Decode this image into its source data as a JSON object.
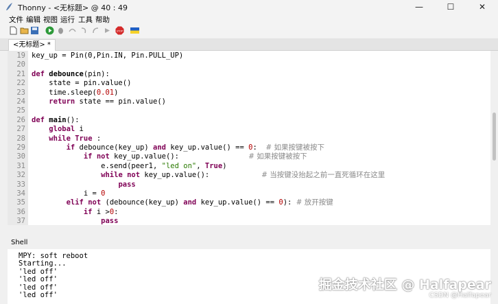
{
  "window": {
    "title": "Thonny  -  <无标题>  @  40 : 49",
    "controls": {
      "minimize": "—",
      "maximize": "☐",
      "close": "✕"
    }
  },
  "menu": [
    "文件",
    "编辑",
    "视图",
    "运行",
    "工具",
    "帮助"
  ],
  "toolbar": {
    "icons": [
      "new-file-icon",
      "open-file-icon",
      "save-icon",
      "run-icon",
      "debug-icon",
      "step-over-icon",
      "step-into-icon",
      "step-out-icon",
      "resume-icon",
      "stop-icon",
      "ukraine-flag-icon"
    ],
    "stop_label": "STOP"
  },
  "tabs": [
    {
      "label": "<无标题> *"
    }
  ],
  "editor": {
    "lines": [
      {
        "n": "19",
        "tokens": [
          {
            "t": "key_up = Pin(0,Pin.IN, Pin.PULL_UP)",
            "c": ""
          }
        ]
      },
      {
        "n": "20",
        "tokens": []
      },
      {
        "n": "21",
        "tokens": [
          {
            "t": "def ",
            "c": "kw"
          },
          {
            "t": "debounce",
            "c": "fn"
          },
          {
            "t": "(pin):",
            "c": ""
          }
        ]
      },
      {
        "n": "22",
        "tokens": [
          {
            "t": "    state = pin.value()",
            "c": ""
          }
        ]
      },
      {
        "n": "23",
        "tokens": [
          {
            "t": "    time.sleep(",
            "c": ""
          },
          {
            "t": "0.01",
            "c": "num"
          },
          {
            "t": ")",
            "c": ""
          }
        ]
      },
      {
        "n": "24",
        "tokens": [
          {
            "t": "    ",
            "c": ""
          },
          {
            "t": "return",
            "c": "kw"
          },
          {
            "t": " state == pin.value()",
            "c": ""
          }
        ]
      },
      {
        "n": "25",
        "tokens": []
      },
      {
        "n": "26",
        "tokens": [
          {
            "t": "def ",
            "c": "kw"
          },
          {
            "t": "main",
            "c": "fn"
          },
          {
            "t": "():",
            "c": ""
          }
        ]
      },
      {
        "n": "27",
        "tokens": [
          {
            "t": "    ",
            "c": ""
          },
          {
            "t": "global",
            "c": "kw"
          },
          {
            "t": " i",
            "c": ""
          }
        ]
      },
      {
        "n": "28",
        "tokens": [
          {
            "t": "    ",
            "c": ""
          },
          {
            "t": "while",
            "c": "kw"
          },
          {
            "t": " ",
            "c": ""
          },
          {
            "t": "True",
            "c": "kw"
          },
          {
            "t": " :",
            "c": ""
          }
        ]
      },
      {
        "n": "29",
        "tokens": [
          {
            "t": "        ",
            "c": ""
          },
          {
            "t": "if",
            "c": "kw"
          },
          {
            "t": " debounce(key_up) ",
            "c": ""
          },
          {
            "t": "and",
            "c": "kw"
          },
          {
            "t": " key_up.value() == ",
            "c": ""
          },
          {
            "t": "0",
            "c": "num"
          },
          {
            "t": ":  ",
            "c": ""
          },
          {
            "t": "# 如果按键被按下",
            "c": "cmt"
          }
        ]
      },
      {
        "n": "30",
        "tokens": [
          {
            "t": "            ",
            "c": ""
          },
          {
            "t": "if",
            "c": "kw"
          },
          {
            "t": " ",
            "c": ""
          },
          {
            "t": "not",
            "c": "kw"
          },
          {
            "t": " key_up.value():                ",
            "c": ""
          },
          {
            "t": "# 如果按键被按下",
            "c": "cmt"
          }
        ]
      },
      {
        "n": "31",
        "tokens": [
          {
            "t": "                e.send(peer1, ",
            "c": ""
          },
          {
            "t": "\"led on\"",
            "c": "str"
          },
          {
            "t": ", ",
            "c": ""
          },
          {
            "t": "True",
            "c": "kw"
          },
          {
            "t": ")",
            "c": ""
          }
        ]
      },
      {
        "n": "32",
        "tokens": [
          {
            "t": "                ",
            "c": ""
          },
          {
            "t": "while",
            "c": "kw"
          },
          {
            "t": " ",
            "c": ""
          },
          {
            "t": "not",
            "c": "kw"
          },
          {
            "t": " key_up.value():            ",
            "c": ""
          },
          {
            "t": "# 当按键没抬起之前一直死循环在这里",
            "c": "cmt"
          }
        ]
      },
      {
        "n": "33",
        "tokens": [
          {
            "t": "                    ",
            "c": ""
          },
          {
            "t": "pass",
            "c": "kw"
          }
        ]
      },
      {
        "n": "34",
        "tokens": [
          {
            "t": "            i = ",
            "c": ""
          },
          {
            "t": "0",
            "c": "num"
          }
        ]
      },
      {
        "n": "35",
        "tokens": [
          {
            "t": "        ",
            "c": ""
          },
          {
            "t": "elif",
            "c": "kw"
          },
          {
            "t": " ",
            "c": ""
          },
          {
            "t": "not",
            "c": "kw"
          },
          {
            "t": " (debounce(key_up) ",
            "c": ""
          },
          {
            "t": "and",
            "c": "kw"
          },
          {
            "t": " key_up.value() == ",
            "c": ""
          },
          {
            "t": "0",
            "c": "num"
          },
          {
            "t": "): ",
            "c": ""
          },
          {
            "t": "# 放开按键",
            "c": "cmt"
          }
        ]
      },
      {
        "n": "36",
        "tokens": [
          {
            "t": "            ",
            "c": ""
          },
          {
            "t": "if",
            "c": "kw"
          },
          {
            "t": " i >",
            "c": ""
          },
          {
            "t": "0",
            "c": "num"
          },
          {
            "t": ":",
            "c": ""
          }
        ]
      },
      {
        "n": "37",
        "tokens": [
          {
            "t": "                ",
            "c": ""
          },
          {
            "t": "pass",
            "c": "kw"
          }
        ]
      }
    ]
  },
  "shell": {
    "tab_label": "Shell",
    "lines": [
      "MPY: soft reboot",
      "Starting...",
      "'led off'",
      "'led off'",
      "'led off'",
      "'led off'"
    ]
  },
  "watermark": {
    "main": "掘金技术社区 @ Halfapear",
    "sub": "CSDN @Halfapear"
  }
}
